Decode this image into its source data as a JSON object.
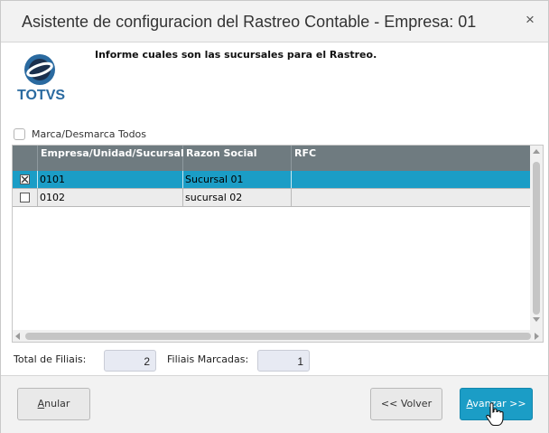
{
  "window": {
    "title": "Asistente de configuracion del Rastreo Contable - Empresa: 01",
    "close_glyph": "×"
  },
  "logo": {
    "text": "TOTVS",
    "colors": {
      "ring": "#2a6aa0",
      "inner": "#1b2f4d"
    }
  },
  "instruction": "Informe cuales son las sucursales para el Rastreo.",
  "mark_all": {
    "label": "Marca/Desmarca Todos",
    "checked": false
  },
  "table": {
    "columns": [
      "Empresa/Unidad/Sucursal",
      "Razon Social",
      "RFC"
    ],
    "rows": [
      {
        "checked": true,
        "empresa": "0101",
        "razon_social": "Sucursal 01",
        "rfc": ""
      },
      {
        "checked": false,
        "empresa": "0102",
        "razon_social": "sucursal 02",
        "rfc": ""
      }
    ],
    "colors": {
      "header": "#6f7b80",
      "selected_row": "#1b9dc6",
      "row": "#ececec"
    }
  },
  "totals": {
    "total_label": "Total de Filiais:",
    "total_value": "2",
    "marked_label": "Filiais Marcadas:",
    "marked_value": "1"
  },
  "buttons": {
    "cancel": "Anular",
    "back": "<< Volver",
    "next": "Avanzar >>"
  },
  "colors": {
    "accent": "#1b9dc6"
  }
}
